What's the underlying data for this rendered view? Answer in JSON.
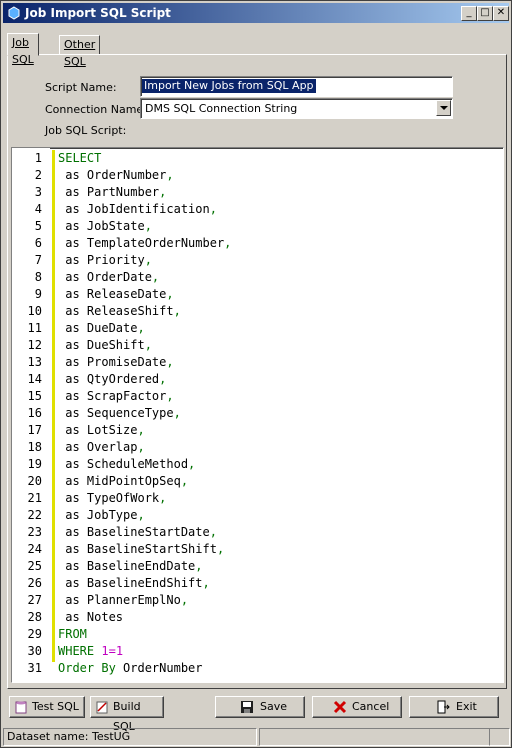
{
  "window": {
    "title": "Job Import SQL Script",
    "title_bg_start": "#0a246a",
    "title_bg_end": "#a6caf0"
  },
  "title_buttons": {
    "minimize": "_",
    "maximize": "□",
    "close": "✕"
  },
  "tabs": [
    {
      "label": "Job SQL",
      "active": true
    },
    {
      "label": "Other SQL",
      "active": false
    }
  ],
  "form": {
    "script_name_label": "Script Name:",
    "script_name_value": "Import New Jobs from SQL App",
    "connection_name_label": "Connection Name:",
    "connection_name_value": "DMS SQL Connection String",
    "job_sql_script_label": "Job SQL Script:"
  },
  "editor": {
    "lines": [
      {
        "num": "1",
        "kw": "SELECT",
        "text": ""
      },
      {
        "num": "2",
        "text": " as OrderNumber",
        "punct": ","
      },
      {
        "num": "3",
        "text": " as PartNumber",
        "punct": ","
      },
      {
        "num": "4",
        "text": " as JobIdentification",
        "punct": ","
      },
      {
        "num": "5",
        "text": " as JobState",
        "punct": ","
      },
      {
        "num": "6",
        "text": " as TemplateOrderNumber",
        "punct": ","
      },
      {
        "num": "7",
        "text": " as Priority",
        "punct": ","
      },
      {
        "num": "8",
        "text": " as OrderDate",
        "punct": ","
      },
      {
        "num": "9",
        "text": " as ReleaseDate",
        "punct": ","
      },
      {
        "num": "10",
        "text": " as ReleaseShift",
        "punct": ","
      },
      {
        "num": "11",
        "text": " as DueDate",
        "punct": ","
      },
      {
        "num": "12",
        "text": " as DueShift",
        "punct": ","
      },
      {
        "num": "13",
        "text": " as PromiseDate",
        "punct": ","
      },
      {
        "num": "14",
        "text": " as QtyOrdered",
        "punct": ","
      },
      {
        "num": "15",
        "text": " as ScrapFactor",
        "punct": ","
      },
      {
        "num": "16",
        "text": " as SequenceType",
        "punct": ","
      },
      {
        "num": "17",
        "text": " as LotSize",
        "punct": ","
      },
      {
        "num": "18",
        "text": " as Overlap",
        "punct": ","
      },
      {
        "num": "19",
        "text": " as ScheduleMethod",
        "punct": ","
      },
      {
        "num": "20",
        "text": " as MidPointOpSeq",
        "punct": ","
      },
      {
        "num": "21",
        "text": " as TypeOfWork",
        "punct": ","
      },
      {
        "num": "22",
        "text": " as JobType",
        "punct": ","
      },
      {
        "num": "23",
        "text": " as BaselineStartDate",
        "punct": ","
      },
      {
        "num": "24",
        "text": " as BaselineStartShift",
        "punct": ","
      },
      {
        "num": "25",
        "text": " as BaselineEndDate",
        "punct": ","
      },
      {
        "num": "26",
        "text": " as BaselineEndShift",
        "punct": ","
      },
      {
        "num": "27",
        "text": " as PlannerEmplNo",
        "punct": ","
      },
      {
        "num": "28",
        "text": " as Notes",
        "punct": ""
      },
      {
        "num": "29",
        "kw": "FROM",
        "text": ""
      },
      {
        "num": "30",
        "kw": "WHERE",
        "text": " ",
        "expr": "1=1"
      },
      {
        "num": "31",
        "kw": "Order By",
        "text": " OrderNumber"
      }
    ]
  },
  "buttons": {
    "test_sql": "Test SQL",
    "build_sql": "Build SQL",
    "save": "Save",
    "cancel": "Cancel",
    "exit": "Exit"
  },
  "status": {
    "dataset": "Dataset name:  TestUG"
  },
  "colors": {
    "keyword": "#007000",
    "number": "#c000c0",
    "selection": "#0a246a",
    "change_marker": "#e0e000"
  }
}
